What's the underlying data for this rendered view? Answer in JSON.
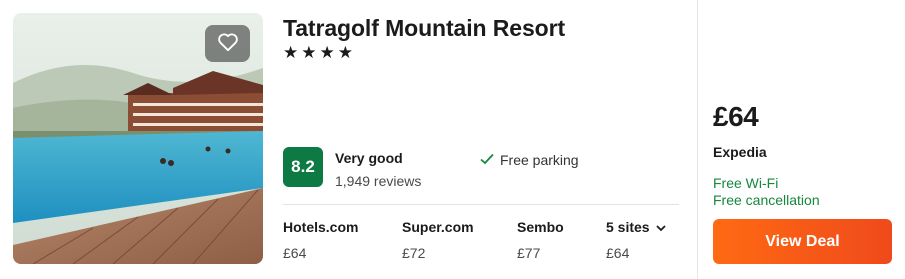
{
  "hotel": {
    "name": "Tatragolf Mountain Resort",
    "stars": "★★★★",
    "rating": {
      "score": "8.2",
      "label": "Very good",
      "reviews": "1,949 reviews",
      "badge_color": "#0e7a43"
    },
    "amenities": [
      {
        "icon": "checkmark-icon",
        "label": "Free parking"
      }
    ]
  },
  "offers": [
    {
      "site": "Hotels.com",
      "price": "£64"
    },
    {
      "site": "Super.com",
      "price": "£72"
    },
    {
      "site": "Sembo",
      "price": "£77"
    },
    {
      "site": "5 sites",
      "price": "£64",
      "icon": "chevron-down-icon"
    }
  ],
  "best_deal": {
    "price": "£64",
    "provider": "Expedia",
    "perks": [
      "Free Wi-Fi",
      "Free cancellation"
    ],
    "perk_color": "#16873e",
    "button_label": "View Deal",
    "button_color": "#ff6a13"
  },
  "image": {
    "icon": "heart-icon"
  }
}
